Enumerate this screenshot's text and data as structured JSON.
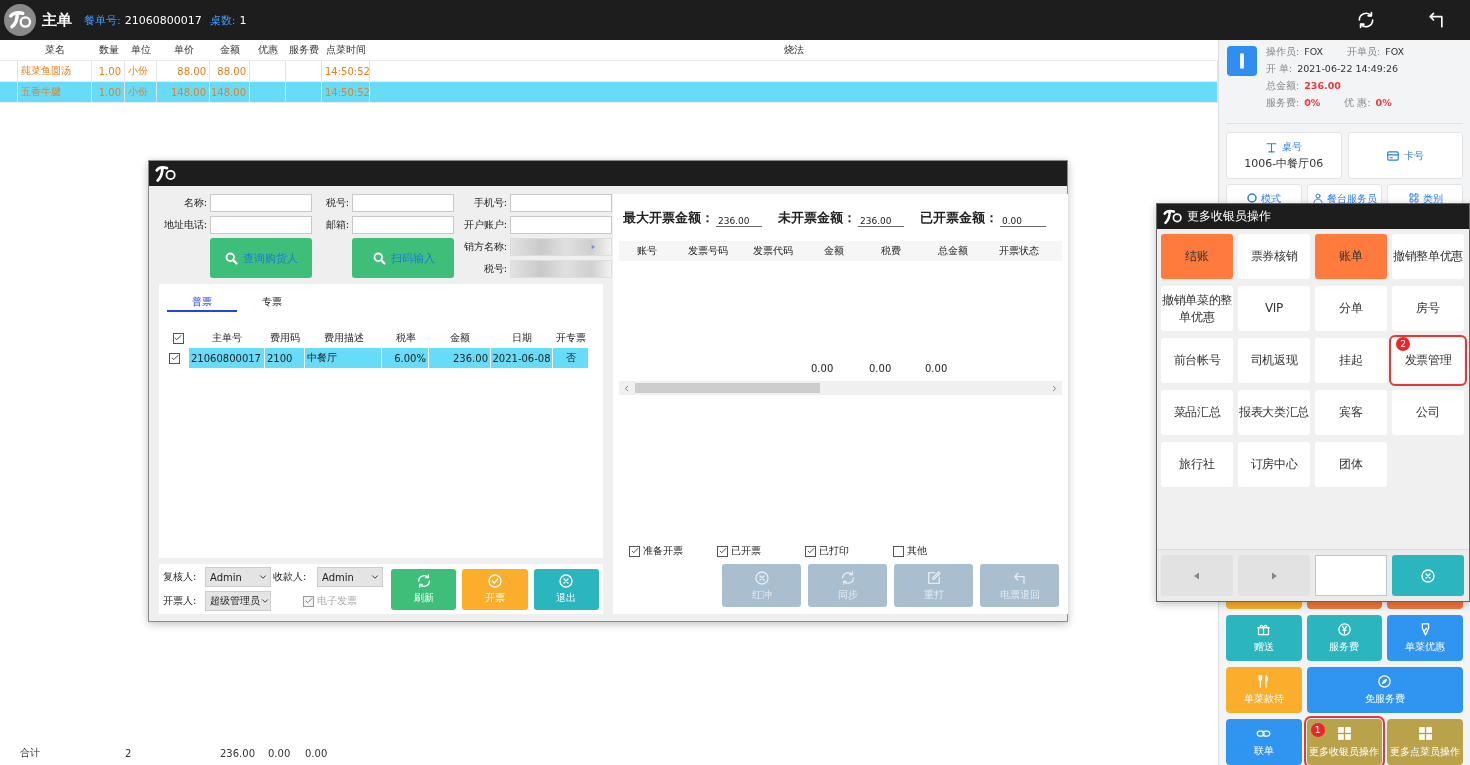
{
  "header": {
    "title": "主单",
    "order_no_label": "餐单号:",
    "order_no": "21060800017",
    "tables_label": "桌数:",
    "tables": "1"
  },
  "order_table": {
    "columns": [
      "菜名",
      "数量",
      "单位",
      "单价",
      "金额",
      "优惠",
      "服务费",
      "点菜时间",
      "烧法"
    ],
    "rows": [
      {
        "selected": false,
        "name": "莼菜鱼圆汤",
        "qty": "1.00",
        "unit": "小份",
        "price": "88.00",
        "amount": "88.00",
        "time": "14:50:52"
      },
      {
        "selected": true,
        "name": "五香牛腱",
        "qty": "1.00",
        "unit": "小份",
        "price": "148.00",
        "amount": "148.00",
        "time": "14:50:52"
      }
    ]
  },
  "totals": {
    "label": "合计",
    "count": "2",
    "amount": "236.00",
    "discount": "0.00",
    "service": "0.00"
  },
  "info": {
    "operator_label": "操作员:",
    "operator": "FOX",
    "opener_label": "开单员:",
    "opener": "FOX",
    "open_label": "开 单:",
    "open_time": "2021-06-22 14:49:26",
    "total_label": "总金额:",
    "total": "236.00",
    "service_label": "服务费:",
    "service": "0%",
    "discount_label": "优 惠:",
    "discount": "0%"
  },
  "table_button": {
    "label": "桌号",
    "value": "1006-中餐厅06"
  },
  "card_button": {
    "label": "卡号"
  },
  "mode_buttons": [
    "模式",
    "餐台服务员",
    "类别"
  ],
  "hidden_tiles": [
    {
      "color": "#fbad2c"
    },
    {
      "color": "#f0763c"
    },
    {
      "color": "#f0763c"
    }
  ],
  "action_tiles": [
    {
      "label": "赠送",
      "color": "#2bb5bf",
      "kind": "normal"
    },
    {
      "label": "服务费",
      "color": "#2bb5bf",
      "kind": "normal"
    },
    {
      "label": "单菜优惠",
      "color": "#2f95f0",
      "kind": "normal"
    },
    {
      "label": "单菜款待",
      "color": "#fbad2c",
      "kind": "normal"
    },
    {
      "label": "免服务费",
      "color": "#2f95f0",
      "kind": "wide"
    },
    {
      "label": "联单",
      "color": "#2f95f0",
      "kind": "normal"
    },
    {
      "label": "更多收银员操作",
      "color": "#b9a24a",
      "kind": "normal",
      "callout": "1"
    },
    {
      "label": "更多点菜员操作",
      "color": "#b9a24a",
      "kind": "normal"
    }
  ],
  "invoice_dialog": {
    "buyer_fields": [
      {
        "label": "名称:"
      },
      {
        "label": "税号:"
      },
      {
        "label": "手机号:"
      },
      {
        "label": "地址电话:"
      },
      {
        "label": "邮箱:"
      },
      {
        "label": "开户账户:"
      }
    ],
    "seller_fields": [
      {
        "label": "销方名称:",
        "kind": "dropdown"
      },
      {
        "label": "税号:",
        "kind": "text"
      }
    ],
    "search_buttons": [
      "查询购货人",
      "扫码输入"
    ],
    "tabs": [
      {
        "label": "普票",
        "selected": true
      },
      {
        "label": "专票",
        "selected": false
      }
    ],
    "header_checked": true,
    "columns": [
      "主单号",
      "费用码",
      "费用描述",
      "税率",
      "金额",
      "日期",
      "开专票"
    ],
    "rows": [
      {
        "checked": true,
        "selected": true,
        "cells": [
          "21060800017",
          "2100",
          "中餐厅",
          "6.00%",
          "236.00",
          "2021-06-08",
          "否"
        ]
      }
    ],
    "reviewer": {
      "label": "复核人:",
      "value": "Admin"
    },
    "payee": {
      "label": "收款人:",
      "value": "Admin"
    },
    "issuer": {
      "label": "开票人:",
      "value": "超级管理员"
    },
    "e_invoice": {
      "label": "电子发票",
      "checked": true,
      "disabled": true
    },
    "actions": [
      {
        "label": "刷新",
        "color": "#3dbf7a"
      },
      {
        "label": "开票",
        "color": "#fbad2c"
      },
      {
        "label": "退出",
        "color": "#2bb5bf"
      }
    ],
    "amounts": [
      {
        "label": "最大开票金额：",
        "value": "236.00"
      },
      {
        "label": "未开票金额：",
        "value": "236.00"
      },
      {
        "label": "已开票金额：",
        "value": "0.00"
      }
    ],
    "invoice_columns": [
      "账号",
      "发票号码",
      "发票代码",
      "金额",
      "税费",
      "总金额",
      "开票状态"
    ],
    "invoice_totals": [
      "0.00",
      "0.00",
      "0.00"
    ],
    "filters": [
      {
        "label": "准备开票",
        "checked": true
      },
      {
        "label": "已开票",
        "checked": true
      },
      {
        "label": "已打印",
        "checked": true
      },
      {
        "label": "其他",
        "checked": false
      }
    ],
    "invoice_actions": [
      {
        "label": "红冲",
        "disabled": true
      },
      {
        "label": "同步",
        "disabled": true
      },
      {
        "label": "重打",
        "disabled": true
      },
      {
        "label": "电票退回",
        "disabled": true
      }
    ]
  },
  "cashier_popup": {
    "title": "更多收银员操作",
    "tiles": [
      {
        "label": "结账",
        "color": "#ff7a3d"
      },
      {
        "label": "票券核销",
        "color": "#ffffff"
      },
      {
        "label": "账单",
        "color": "#ff7a3d"
      },
      {
        "label": "撤销整单优惠",
        "color": "#ffffff"
      },
      {
        "label": "撤销单菜的整单优惠",
        "color": "#ffffff"
      },
      {
        "label": "VIP",
        "color": "#ffffff"
      },
      {
        "label": "分单",
        "color": "#ffffff"
      },
      {
        "label": "房号",
        "color": "#ffffff"
      },
      {
        "label": "前台帐号",
        "color": "#ffffff"
      },
      {
        "label": "司机返现",
        "color": "#ffffff"
      },
      {
        "label": "挂起",
        "color": "#ffffff"
      },
      {
        "label": "发票管理",
        "color": "#ffffff",
        "callout": "2"
      },
      {
        "label": "菜品汇总",
        "color": "#ffffff"
      },
      {
        "label": "报表大类汇总",
        "color": "#ffffff"
      },
      {
        "label": "宾客",
        "color": "#ffffff"
      },
      {
        "label": "公司",
        "color": "#ffffff"
      },
      {
        "label": "旅行社",
        "color": "#ffffff"
      },
      {
        "label": "订房中心",
        "color": "#ffffff"
      },
      {
        "label": "团体",
        "color": "#ffffff"
      }
    ]
  }
}
